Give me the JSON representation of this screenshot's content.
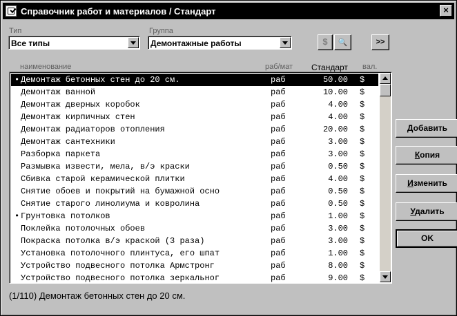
{
  "window": {
    "title": "Справочник работ и материалов  /  Стандарт",
    "close_label": "×"
  },
  "filters": {
    "type_label": "Тип",
    "type_value": "Все типы",
    "group_label": "Группа",
    "group_value": "Демонтажные работы"
  },
  "toolbar": {
    "dollar_label": "$",
    "binoculars_label": "🔍",
    "next_label": ">>"
  },
  "columns": {
    "name": "наименование",
    "unit": "раб/мат",
    "price": "Стандарт",
    "currency": "вал."
  },
  "rows": [
    {
      "mark": "•",
      "name": "Демонтаж бетонных стен до 20 см.",
      "unit": "раб",
      "price": "50.00",
      "currency": "$"
    },
    {
      "mark": "",
      "name": "Демонтаж ванной",
      "unit": "раб",
      "price": "10.00",
      "currency": "$"
    },
    {
      "mark": "",
      "name": "Демонтаж дверных коробок",
      "unit": "раб",
      "price": "4.00",
      "currency": "$"
    },
    {
      "mark": "",
      "name": "Демонтаж кирпичных стен",
      "unit": "раб",
      "price": "4.00",
      "currency": "$"
    },
    {
      "mark": "",
      "name": "Демонтаж радиаторов отопления",
      "unit": "раб",
      "price": "20.00",
      "currency": "$"
    },
    {
      "mark": "",
      "name": "Демонтаж сантехники",
      "unit": "раб",
      "price": "3.00",
      "currency": "$"
    },
    {
      "mark": "",
      "name": "Разборка паркета",
      "unit": "раб",
      "price": "3.00",
      "currency": "$"
    },
    {
      "mark": "",
      "name": "Размывка извести, мела, в/э краски",
      "unit": "раб",
      "price": "0.50",
      "currency": "$"
    },
    {
      "mark": "",
      "name": "Сбивка старой керамической плитки",
      "unit": "раб",
      "price": "4.00",
      "currency": "$"
    },
    {
      "mark": "",
      "name": "Снятие обоев и покрытий на бумажной осно",
      "unit": "раб",
      "price": "0.50",
      "currency": "$"
    },
    {
      "mark": "",
      "name": "Снятие старого линолиума и ковролина",
      "unit": "раб",
      "price": "0.50",
      "currency": "$"
    },
    {
      "mark": "•",
      "name": "Грунтовка потолков",
      "unit": "раб",
      "price": "1.00",
      "currency": "$"
    },
    {
      "mark": "",
      "name": "Поклейка потолочных обоев",
      "unit": "раб",
      "price": "3.00",
      "currency": "$"
    },
    {
      "mark": "",
      "name": "Покраска потолка в/э краской (3 раза)",
      "unit": "раб",
      "price": "3.00",
      "currency": "$"
    },
    {
      "mark": "",
      "name": "Установка потолочного плинтуса, его шпат",
      "unit": "раб",
      "price": "1.00",
      "currency": "$"
    },
    {
      "mark": "",
      "name": "Устройство подвесного потолка Армстронг",
      "unit": "раб",
      "price": "8.00",
      "currency": "$"
    },
    {
      "mark": "",
      "name": "Устройство подвесного потолка зеркальног",
      "unit": "раб",
      "price": "9.00",
      "currency": "$"
    }
  ],
  "buttons": {
    "add_accel": "Д",
    "add_rest": "обавить",
    "copy_accel": "К",
    "copy_rest": "опия",
    "edit_accel": "И",
    "edit_rest": "зменить",
    "delete_accel": "У",
    "delete_rest": "далить",
    "ok_label": "OK"
  },
  "status": {
    "text": "(1/110)  Демонтаж бетонных стен до 20 см."
  }
}
